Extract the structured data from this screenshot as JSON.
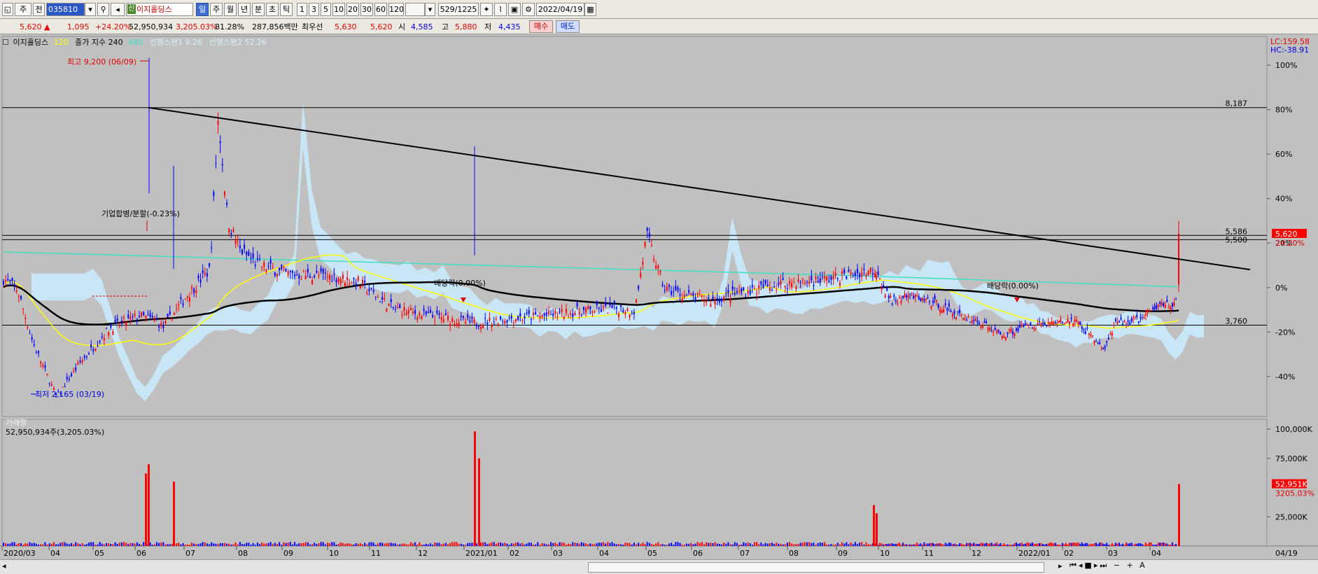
{
  "toolbar": {
    "market": "주",
    "prev_label": "전",
    "stock_code": "035810",
    "stock_badge": "신",
    "stock_name": "이지홀딩스",
    "periods": [
      "일",
      "주",
      "월",
      "년",
      "분",
      "초",
      "틱"
    ],
    "active_period": "일",
    "intervals": [
      "1",
      "3",
      "5",
      "10",
      "20",
      "30",
      "60",
      "120"
    ],
    "page_counter": "529/1225",
    "date": "2022/04/19"
  },
  "quote": {
    "price": "5,620 ▲",
    "change": "1,095",
    "change_pct": "+24.20%",
    "volume": "52,950,934",
    "volume_ratio": "3,205.03%",
    "turnover_rate": "81.28%",
    "amount": "287,856백만",
    "priority_label": "최우선",
    "ask": "5,630",
    "bid": "5,620",
    "open_label": "시",
    "open": "4,585",
    "high_label": "고",
    "high": "5,880",
    "low_label": "저",
    "low": "4,435",
    "buy_label": "매수",
    "sell_label": "매도"
  },
  "legend": {
    "name": "이지홀딩스",
    "ma1": "120",
    "ma2": "종가 지수 240",
    "ma3": "480",
    "span1": "선행스팬1 9.26",
    "span2": "선행스팬2 52.26"
  },
  "colors": {
    "up": "#ff0000",
    "down": "#0000ff",
    "ma120": "#ffff00",
    "ma240": "#000000",
    "ma480": "#40e0c0",
    "cloud": "#c8e8f8",
    "bg": "#c0c0c0"
  },
  "chart_data": {
    "type": "candlestick",
    "x_labels": [
      "2020/03",
      "04",
      "05",
      "06",
      "07",
      "08",
      "09",
      "10",
      "11",
      "12",
      "2021/01",
      "02",
      "03",
      "04",
      "05",
      "06",
      "07",
      "08",
      "09",
      "10",
      "11",
      "12",
      "2022/01",
      "02",
      "03",
      "04",
      "04/19"
    ],
    "right_axis_pct": [
      "100%",
      "80%",
      "60%",
      "40%",
      "20%",
      "0%",
      "-20%",
      "-40%"
    ],
    "left_axis_top": "LC:159.58",
    "left_axis_bottom": "HC:-38.91",
    "levels": {
      "resistance_high": "8,187",
      "resistance_mid_a": "5,586",
      "resistance_mid_b": "5,500",
      "support": "3,760"
    },
    "current_price": "5,620",
    "current_change_pct": "24.20%",
    "annotations": {
      "high": "최고 9,200 (06/09)",
      "low": "최저 2,165 (03/19)",
      "merge": "기업합병/분할(-0.23%)",
      "dividend_1": "배당락(0.00%)",
      "dividend_2": "배당락(0.00%)"
    },
    "trend_from": {
      "date": "2020/06/09",
      "price": 8187
    },
    "trend_to": {
      "date": "2022/04/19",
      "price": 4890
    },
    "volume": {
      "title": "거래량",
      "value": "52,950,934주(3,205.03%)",
      "axis": [
        "100,000K",
        "75,000K",
        "25,000K"
      ],
      "last": "52,951K",
      "last_pct": "3205.03%"
    }
  }
}
